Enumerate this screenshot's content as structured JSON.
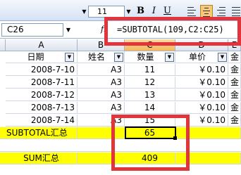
{
  "toolbar": {
    "font_size": "11",
    "bold_label": "B",
    "italic_label": "I",
    "underline_label": "U"
  },
  "formula_bar": {
    "name_box": "C26",
    "fx_label": "fx",
    "formula": "=SUBTOTAL(109,C2:C25)"
  },
  "columns": [
    "A",
    "B",
    "C",
    "D",
    "E"
  ],
  "header_row": {
    "date": "日期",
    "name": "姓名",
    "quantity": "数量",
    "price": "单价",
    "extra": "金"
  },
  "rows": [
    {
      "date": "2008-7-10",
      "name": "A3",
      "quantity": "11",
      "price": "￥0.10",
      "extra": "金"
    },
    {
      "date": "2008-7-11",
      "name": "A3",
      "quantity": "12",
      "price": "￥0.10",
      "extra": "金"
    },
    {
      "date": "2008-7-12",
      "name": "A3",
      "quantity": "13",
      "price": "￥0.10",
      "extra": "金"
    },
    {
      "date": "2008-7-13",
      "name": "A3",
      "quantity": "14",
      "price": "￥0.10",
      "extra": "金"
    },
    {
      "date": "2008-7-14",
      "name": "A3",
      "quantity": "15",
      "price": "￥0.10",
      "extra": "金"
    }
  ],
  "subtotal_row": {
    "label": "SUBTOTAL汇总",
    "value": "65"
  },
  "sum_row": {
    "label": "SUM汇总",
    "value": "409"
  },
  "colors": {
    "highlight_red": "#e2343b",
    "summary_yellow": "#ffff00",
    "active_header": "#f5b75b"
  }
}
